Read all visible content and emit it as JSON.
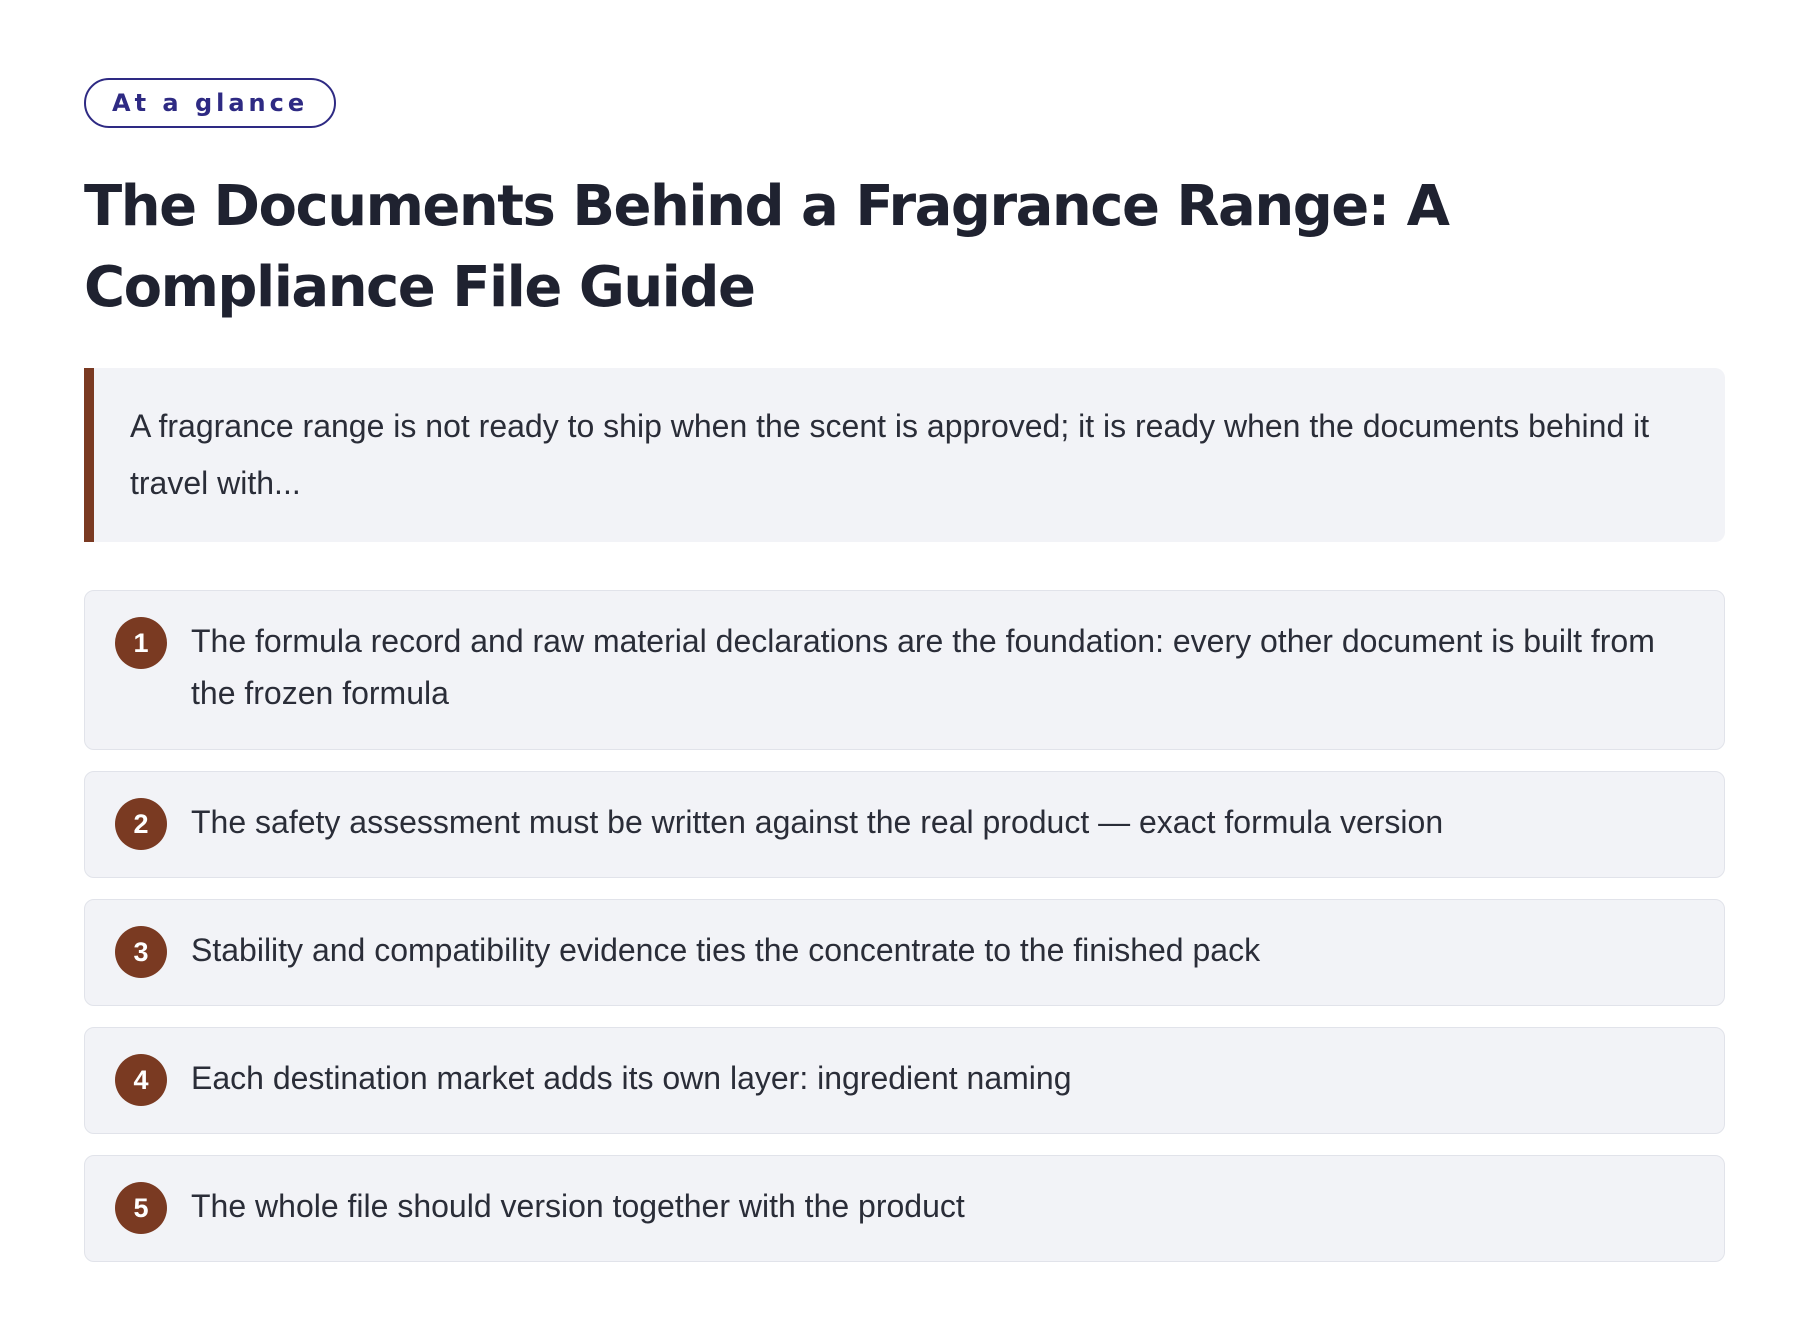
{
  "badge": "At a glance",
  "title": "The Documents Behind a Fragrance Range: A Compliance File Guide",
  "lede": "A fragrance range is not ready to ship when the scent is approved; it is ready when the documents behind it travel with...",
  "points": [
    {
      "number": "1",
      "text": "The formula record and raw material declarations are the foundation: every other document is built from the frozen formula"
    },
    {
      "number": "2",
      "text": "The safety assessment must be written against the real product — exact formula version"
    },
    {
      "number": "3",
      "text": "Stability and compatibility evidence ties the concentrate to the finished pack"
    },
    {
      "number": "4",
      "text": "Each destination market adds its own layer: ingredient naming"
    },
    {
      "number": "5",
      "text": "The whole file should version together with the product"
    }
  ],
  "colors": {
    "accent": "#7a3a22",
    "badge": "#2e2a83",
    "card_background": "#f2f3f7",
    "text": "#1f2230"
  }
}
